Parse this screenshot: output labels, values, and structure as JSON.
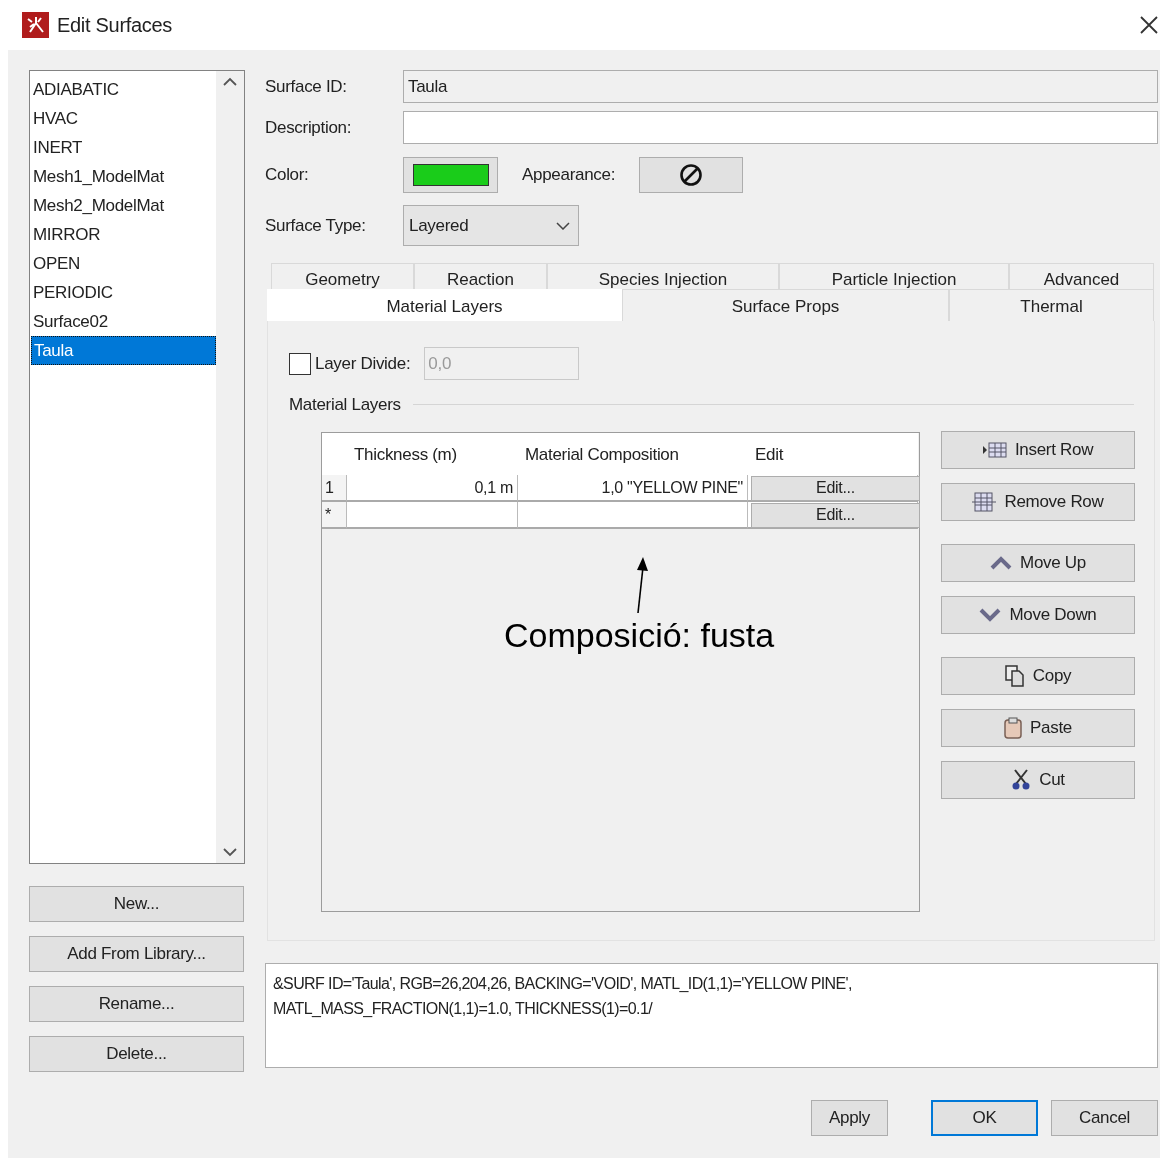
{
  "window": {
    "title": "Edit Surfaces"
  },
  "surfaces": [
    {
      "label": "ADIABATIC",
      "selected": false
    },
    {
      "label": "HVAC",
      "selected": false
    },
    {
      "label": "INERT",
      "selected": false
    },
    {
      "label": "Mesh1_ModelMat",
      "selected": false
    },
    {
      "label": "Mesh2_ModelMat",
      "selected": false
    },
    {
      "label": "MIRROR",
      "selected": false
    },
    {
      "label": "OPEN",
      "selected": false
    },
    {
      "label": "PERIODIC",
      "selected": false
    },
    {
      "label": "Surface02",
      "selected": false
    },
    {
      "label": "Taula",
      "selected": true
    }
  ],
  "left_buttons": [
    "New...",
    "Add From Library...",
    "Rename...",
    "Delete..."
  ],
  "form": {
    "surface_id_label": "Surface ID:",
    "surface_id": "Taula",
    "description_label": "Description:",
    "color_label": "Color:",
    "color": "#1acc1a",
    "appearance_label": "Appearance:",
    "surface_type_label": "Surface Type:",
    "surface_type": "Layered"
  },
  "tab_rows": [
    [
      {
        "label": "Geometry",
        "selected": false
      },
      {
        "label": "Reaction",
        "selected": false
      },
      {
        "label": "Species Injection",
        "selected": false
      },
      {
        "label": "Particle Injection",
        "selected": false
      },
      {
        "label": "Advanced",
        "selected": false
      }
    ],
    [
      {
        "label": "Material Layers",
        "selected": true
      },
      {
        "label": "Surface Props",
        "selected": false
      },
      {
        "label": "Thermal",
        "selected": false
      }
    ]
  ],
  "layer_divide": {
    "label": "Layer Divide:",
    "checked": false,
    "value": "0,0",
    "disabled": true
  },
  "group_label": "Material Layers",
  "table": {
    "columns": [
      "Thickness (m)",
      "Material Composition",
      "Edit"
    ],
    "rows": [
      {
        "header": "1",
        "thickness": "0,1 m",
        "composition": "1,0 \"YELLOW PINE\"",
        "edit": "Edit..."
      },
      {
        "header": "*",
        "edit": "Edit..."
      }
    ]
  },
  "side_buttons": [
    {
      "label": "Insert Row",
      "kind": "insert"
    },
    {
      "label": "Remove Row",
      "kind": "remove"
    },
    {
      "label": "Move Up",
      "kind": "up"
    },
    {
      "label": "Move Down",
      "kind": "down"
    },
    {
      "label": "Copy",
      "kind": "copy"
    },
    {
      "label": "Paste",
      "kind": "paste"
    },
    {
      "label": "Cut",
      "kind": "cut"
    }
  ],
  "code_lines": [
    "&SURF ID='Taula', RGB=26,204,26, BACKING='VOID', MATL_ID(1,1)='YELLOW PINE',",
    "MATL_MASS_FRACTION(1,1)=1.0, THICKNESS(1)=0.1/"
  ],
  "dialog_buttons": [
    {
      "label": "Apply",
      "default": false
    },
    {
      "label": "OK",
      "default": true
    },
    {
      "label": "Cancel",
      "default": false
    }
  ],
  "annotation": {
    "text": "Composició: fusta"
  }
}
